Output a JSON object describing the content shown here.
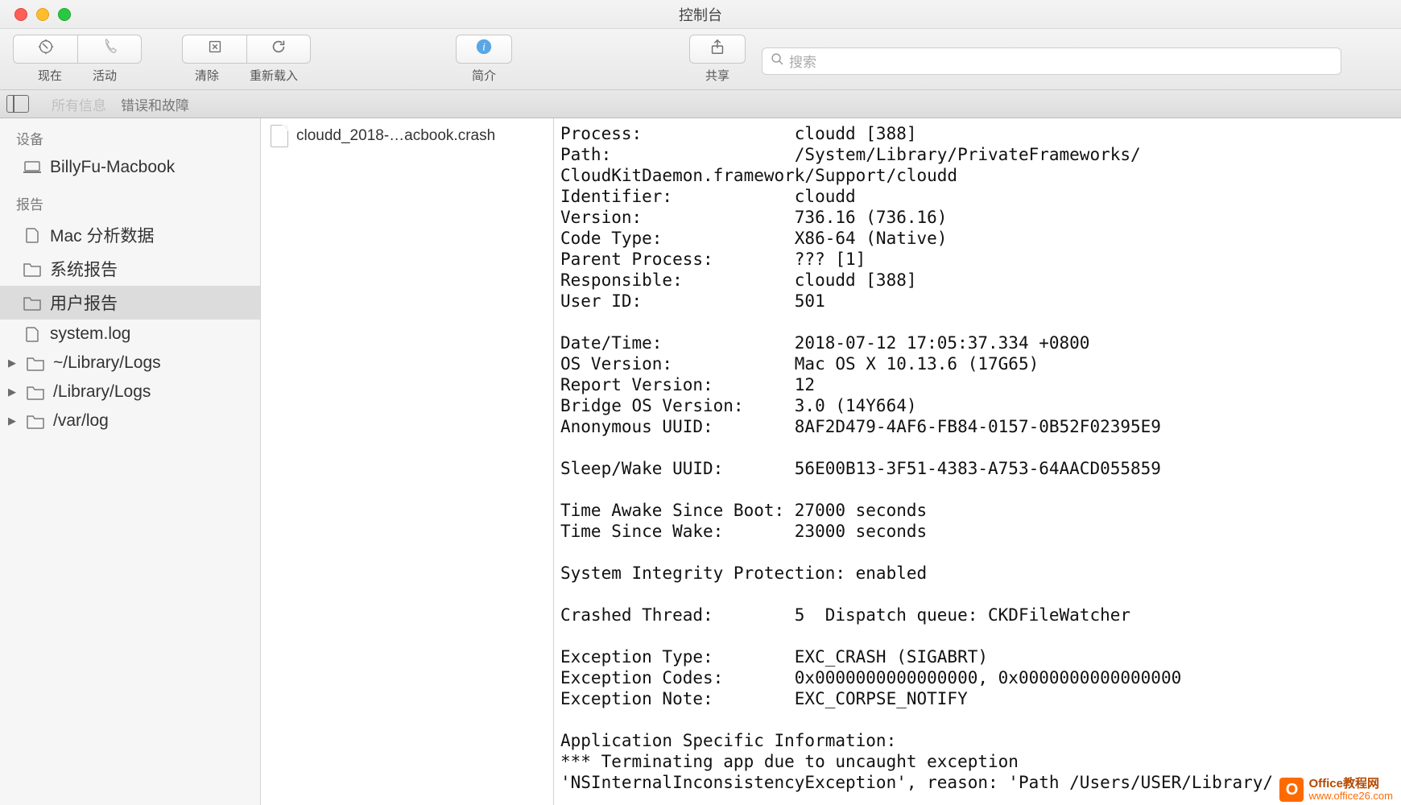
{
  "window": {
    "title": "控制台"
  },
  "toolbar": {
    "now_label": "现在",
    "activity_label": "活动",
    "clear_label": "清除",
    "reload_label": "重新载入",
    "info_label": "简介",
    "share_label": "共享",
    "search_placeholder": "搜索"
  },
  "filterbar": {
    "all_info": "所有信息",
    "errors": "错误和故障"
  },
  "sidebar": {
    "devices_header": "设备",
    "device_name": "BillyFu-Macbook",
    "reports_header": "报告",
    "items": [
      {
        "label": "Mac 分析数据",
        "type": "doc"
      },
      {
        "label": "系统报告",
        "type": "folder"
      },
      {
        "label": "用户报告",
        "type": "folder",
        "selected": true
      },
      {
        "label": "system.log",
        "type": "doc"
      },
      {
        "label": "~/Library/Logs",
        "type": "folder",
        "disclosure": true
      },
      {
        "label": "/Library/Logs",
        "type": "folder",
        "disclosure": true
      },
      {
        "label": "/var/log",
        "type": "folder",
        "disclosure": true
      }
    ]
  },
  "filelist": {
    "items": [
      {
        "name": "cloudd_2018-…acbook.crash"
      }
    ]
  },
  "crash_report": {
    "lines": [
      "Process:               cloudd [388]",
      "Path:                  /System/Library/PrivateFrameworks/",
      "CloudKitDaemon.framework/Support/cloudd",
      "Identifier:            cloudd",
      "Version:               736.16 (736.16)",
      "Code Type:             X86-64 (Native)",
      "Parent Process:        ??? [1]",
      "Responsible:           cloudd [388]",
      "User ID:               501",
      "",
      "Date/Time:             2018-07-12 17:05:37.334 +0800",
      "OS Version:            Mac OS X 10.13.6 (17G65)",
      "Report Version:        12",
      "Bridge OS Version:     3.0 (14Y664)",
      "Anonymous UUID:        8AF2D479-4AF6-FB84-0157-0B52F02395E9",
      "",
      "Sleep/Wake UUID:       56E00B13-3F51-4383-A753-64AACD055859",
      "",
      "Time Awake Since Boot: 27000 seconds",
      "Time Since Wake:       23000 seconds",
      "",
      "System Integrity Protection: enabled",
      "",
      "Crashed Thread:        5  Dispatch queue: CKDFileWatcher",
      "",
      "Exception Type:        EXC_CRASH (SIGABRT)",
      "Exception Codes:       0x0000000000000000, 0x0000000000000000",
      "Exception Note:        EXC_CORPSE_NOTIFY",
      "",
      "Application Specific Information:",
      "*** Terminating app due to uncaught exception",
      "'NSInternalInconsistencyException', reason: 'Path /Users/USER/Library/"
    ]
  },
  "watermark": {
    "line1": "Office教程网",
    "line2": "www.office26.com"
  }
}
